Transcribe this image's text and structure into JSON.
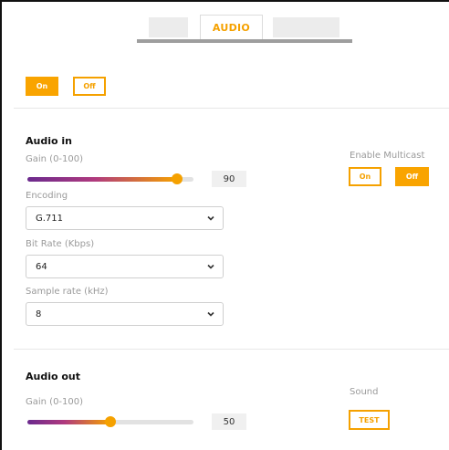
{
  "tabs": {
    "active_label": "AUDIO"
  },
  "audio_toggle": {
    "on_label": "On",
    "off_label": "Off"
  },
  "audio_in": {
    "title": "Audio in",
    "gain_label": "Gain (0-100)",
    "gain_value": "90",
    "encoding_label": "Encoding",
    "encoding_value": "G.711",
    "bitrate_label": "Bit Rate (Kbps)",
    "bitrate_value": "64",
    "samplerate_label": "Sample rate (kHz)",
    "samplerate_value": "8",
    "multicast_label": "Enable Multicast",
    "multicast_on_label": "On",
    "multicast_off_label": "Off"
  },
  "audio_out": {
    "title": "Audio out",
    "gain_label": "Gain (0-100)",
    "gain_value": "50",
    "sound_label": "Sound",
    "test_label": "TEST"
  },
  "colors": {
    "accent": "#f5a100",
    "slider_start": "#6b2a8e",
    "slider_track": "#e2e2e2"
  },
  "icons": {
    "select_chevron": "chevron-down-icon"
  }
}
